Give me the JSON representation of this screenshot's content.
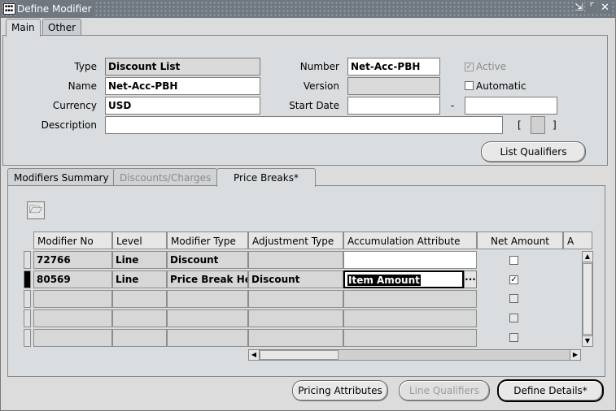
{
  "window": {
    "title": "Define Modifier",
    "controls": [
      "minimize",
      "maximize",
      "close"
    ],
    "app_icon_text": "oracle app"
  },
  "main_tabs": [
    {
      "label": "Main",
      "active": true
    },
    {
      "label": "Other",
      "active": false
    }
  ],
  "header": {
    "type_label": "Type",
    "type_value": "Discount List",
    "name_label": "Name",
    "name_value": "Net-Acc-PBH",
    "currency_label": "Currency",
    "currency_value": "USD",
    "description_label": "Description",
    "description_value": "",
    "number_label": "Number",
    "number_value": "Net-Acc-PBH",
    "version_label": "Version",
    "version_value": "",
    "start_date_label": "Start Date",
    "start_date_value": "",
    "date_separator": "-",
    "end_date_value": "",
    "active_label": "Active",
    "active_checked": true,
    "automatic_label": "Automatic",
    "automatic_checked": false,
    "flex_open": "[",
    "flex_close": "]",
    "list_qualifiers_label": "List Qualifiers"
  },
  "sub_tabs": [
    {
      "label": "Modifiers Summary",
      "active": false
    },
    {
      "label": "Discounts/Charges",
      "active": false,
      "disabled": true
    },
    {
      "label": "Price Breaks*",
      "active": true
    }
  ],
  "grid": {
    "columns": [
      "Modifier No",
      "Level",
      "Modifier Type",
      "Adjustment Type",
      "Accumulation Attribute",
      "Net Amount",
      "A"
    ],
    "rows": [
      {
        "modifier_no": "72766",
        "level": "Line",
        "modifier_type": "Discount",
        "adjustment_type": "",
        "accumulation_attribute": "",
        "net_amount": false
      },
      {
        "modifier_no": "80569",
        "level": "Line",
        "modifier_type": "Price Break He",
        "adjustment_type": "Discount",
        "accumulation_attribute": "Item Amount",
        "net_amount": true
      },
      {
        "modifier_no": "",
        "level": "",
        "modifier_type": "",
        "adjustment_type": "",
        "accumulation_attribute": "",
        "net_amount": false
      },
      {
        "modifier_no": "",
        "level": "",
        "modifier_type": "",
        "adjustment_type": "",
        "accumulation_attribute": "",
        "net_amount": false
      },
      {
        "modifier_no": "",
        "level": "",
        "modifier_type": "",
        "adjustment_type": "",
        "accumulation_attribute": "",
        "net_amount": false
      }
    ],
    "lov_button": "...",
    "icons": [
      "open-folder-icon",
      "scroll-up-icon",
      "scroll-down-icon",
      "scroll-left-icon",
      "scroll-right-icon"
    ]
  },
  "footer": {
    "pricing_attributes_label": "Pricing Attributes",
    "line_qualifiers_label": "Line Qualifiers",
    "define_details_label": "Define Details*"
  }
}
